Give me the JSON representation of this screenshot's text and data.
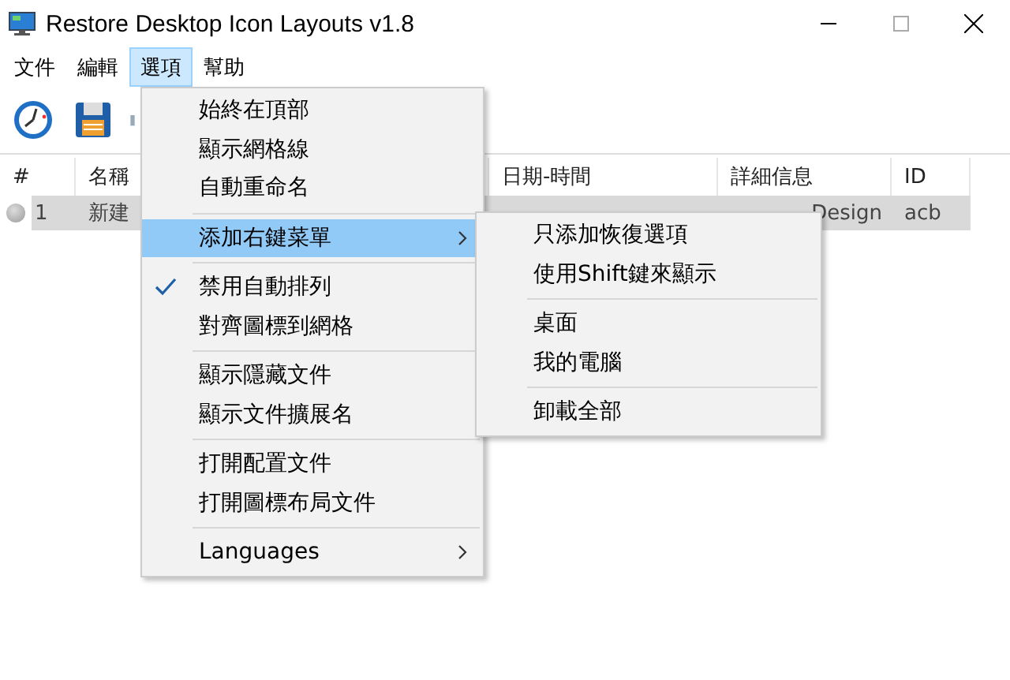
{
  "window": {
    "title": "Restore Desktop Icon Layouts v1.8"
  },
  "menubar": [
    {
      "label": "文件",
      "selected": false
    },
    {
      "label": "編輯",
      "selected": false
    },
    {
      "label": "選項",
      "selected": true
    },
    {
      "label": "幫助",
      "selected": false
    }
  ],
  "table": {
    "columns": [
      "#",
      "名稱",
      "日期-時間",
      "詳細信息",
      "ID"
    ],
    "rows": [
      {
        "index": "1",
        "name": "新建",
        "details": "Design",
        "id": "acb"
      }
    ]
  },
  "menu": [
    {
      "kind": "item",
      "label": "始終在頂部",
      "checked": false,
      "selected": false,
      "submenu": false
    },
    {
      "kind": "item",
      "label": "顯示網格線",
      "checked": false,
      "selected": false,
      "submenu": false
    },
    {
      "kind": "item",
      "label": "自動重命名",
      "checked": false,
      "selected": false,
      "submenu": false
    },
    {
      "kind": "separator"
    },
    {
      "kind": "item",
      "label": "添加右鍵菜單",
      "checked": false,
      "selected": true,
      "submenu": true
    },
    {
      "kind": "separator"
    },
    {
      "kind": "item",
      "label": "禁用自動排列",
      "checked": true,
      "selected": false,
      "submenu": false
    },
    {
      "kind": "item",
      "label": "對齊圖標到網格",
      "checked": false,
      "selected": false,
      "submenu": false
    },
    {
      "kind": "separator"
    },
    {
      "kind": "item",
      "label": "顯示隱藏文件",
      "checked": false,
      "selected": false,
      "submenu": false
    },
    {
      "kind": "item",
      "label": "顯示文件擴展名",
      "checked": false,
      "selected": false,
      "submenu": false
    },
    {
      "kind": "separator"
    },
    {
      "kind": "item",
      "label": "打開配置文件",
      "checked": false,
      "selected": false,
      "submenu": false
    },
    {
      "kind": "item",
      "label": "打開圖標布局文件",
      "checked": false,
      "selected": false,
      "submenu": false
    },
    {
      "kind": "separator"
    },
    {
      "kind": "item",
      "label": "Languages",
      "checked": false,
      "selected": false,
      "submenu": true
    }
  ],
  "submenu": [
    {
      "kind": "item",
      "label": "只添加恢復選項"
    },
    {
      "kind": "item",
      "label": "使用Shift鍵來顯示"
    },
    {
      "kind": "separator"
    },
    {
      "kind": "item",
      "label": "桌面"
    },
    {
      "kind": "item",
      "label": "我的電腦"
    },
    {
      "kind": "separator"
    },
    {
      "kind": "item",
      "label": "卸載全部"
    }
  ]
}
